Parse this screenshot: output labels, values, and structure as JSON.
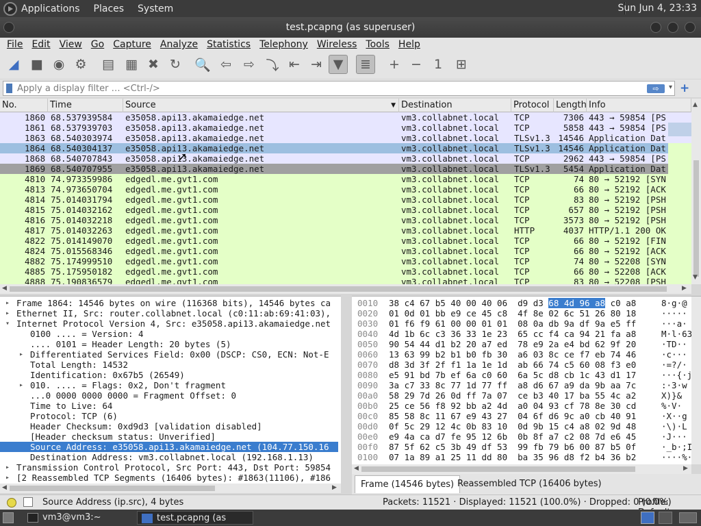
{
  "system_panel": {
    "menus": [
      "Applications",
      "Places",
      "System"
    ],
    "clock": "Sun Jun 4, 23:33"
  },
  "window": {
    "title": "test.pcapng (as superuser)"
  },
  "menubar": [
    "File",
    "Edit",
    "View",
    "Go",
    "Capture",
    "Analyze",
    "Statistics",
    "Telephony",
    "Wireless",
    "Tools",
    "Help"
  ],
  "toolbar": [
    {
      "name": "start-capture",
      "glyph": "◢"
    },
    {
      "name": "stop-capture",
      "glyph": "■"
    },
    {
      "name": "restart-capture",
      "glyph": "◉"
    },
    {
      "name": "capture-options",
      "glyph": "⚙"
    },
    {
      "name": "open-file",
      "glyph": "▤"
    },
    {
      "name": "save-file",
      "glyph": "▦"
    },
    {
      "name": "close-file",
      "glyph": "✖"
    },
    {
      "name": "reload-file",
      "glyph": "↻"
    },
    {
      "name": "find-packet",
      "glyph": "🔍"
    },
    {
      "name": "go-back",
      "glyph": "⇦"
    },
    {
      "name": "go-forward",
      "glyph": "⇨"
    },
    {
      "name": "go-to-packet",
      "glyph": "⤵"
    },
    {
      "name": "go-first",
      "glyph": "⇤"
    },
    {
      "name": "go-last",
      "glyph": "⇥"
    },
    {
      "name": "auto-scroll",
      "glyph": "▼"
    },
    {
      "name": "colorize",
      "glyph": "≣"
    },
    {
      "name": "zoom-in",
      "glyph": "+"
    },
    {
      "name": "zoom-out",
      "glyph": "−"
    },
    {
      "name": "normal-size",
      "glyph": "1"
    },
    {
      "name": "resize-columns",
      "glyph": "⊞"
    }
  ],
  "filter": {
    "placeholder": "Apply a display filter … <Ctrl-/>",
    "apply": "⇨",
    "add": "+"
  },
  "packet_list": {
    "columns": [
      "No.",
      "Time",
      "Source",
      "Destination",
      "Protocol",
      "Length",
      "Info"
    ],
    "rows": [
      {
        "no": "1860",
        "time": "68.537939584",
        "src": "e35058.api13.akamaiedge.net",
        "dst": "vm3.collabnet.local",
        "proto": "TCP",
        "len": "7306",
        "info": "443 → 59854 [PS",
        "color": "blue"
      },
      {
        "no": "1861",
        "time": "68.537939703",
        "src": "e35058.api13.akamaiedge.net",
        "dst": "vm3.collabnet.local",
        "proto": "TCP",
        "len": "5858",
        "info": "443 → 59854 [PS",
        "color": "blue"
      },
      {
        "no": "1863",
        "time": "68.540303974",
        "src": "e35058.api13.akamaiedge.net",
        "dst": "vm3.collabnet.local",
        "proto": "TLSv1.3",
        "len": "14546",
        "info": "Application Dat",
        "color": "blue"
      },
      {
        "no": "1864",
        "time": "68.540304137",
        "src": "e35058.api13.akamaiedge.net",
        "dst": "vm3.collabnet.local",
        "proto": "TLSv1.3",
        "len": "14546",
        "info": "Application Dat",
        "color": "sel"
      },
      {
        "no": "1868",
        "time": "68.540707843",
        "src": "e35058.api13.akamaiedge.net",
        "dst": "vm3.collabnet.local",
        "proto": "TCP",
        "len": "2962",
        "info": "443 → 59854 [PS",
        "color": "blue"
      },
      {
        "no": "1869",
        "time": "68.540707955",
        "src": "e35058.api13.akamaiedge.net",
        "dst": "vm3.collabnet.local",
        "proto": "TLSv1.3",
        "len": "5454",
        "info": "Application Dat",
        "color": "gray"
      },
      {
        "no": "4810",
        "time": "74.973359986",
        "src": "edgedl.me.gvt1.com",
        "dst": "vm3.collabnet.local",
        "proto": "TCP",
        "len": "74",
        "info": "80 → 52192 [SYN",
        "color": "green"
      },
      {
        "no": "4813",
        "time": "74.973650704",
        "src": "edgedl.me.gvt1.com",
        "dst": "vm3.collabnet.local",
        "proto": "TCP",
        "len": "66",
        "info": "80 → 52192 [ACK",
        "color": "green"
      },
      {
        "no": "4814",
        "time": "75.014031794",
        "src": "edgedl.me.gvt1.com",
        "dst": "vm3.collabnet.local",
        "proto": "TCP",
        "len": "83",
        "info": "80 → 52192 [PSH",
        "color": "green"
      },
      {
        "no": "4815",
        "time": "75.014032162",
        "src": "edgedl.me.gvt1.com",
        "dst": "vm3.collabnet.local",
        "proto": "TCP",
        "len": "657",
        "info": "80 → 52192 [PSH",
        "color": "green"
      },
      {
        "no": "4816",
        "time": "75.014032218",
        "src": "edgedl.me.gvt1.com",
        "dst": "vm3.collabnet.local",
        "proto": "TCP",
        "len": "3573",
        "info": "80 → 52192 [PSH",
        "color": "green"
      },
      {
        "no": "4817",
        "time": "75.014032263",
        "src": "edgedl.me.gvt1.com",
        "dst": "vm3.collabnet.local",
        "proto": "HTTP",
        "len": "4037",
        "info": "HTTP/1.1 200 OK",
        "color": "green"
      },
      {
        "no": "4822",
        "time": "75.014149070",
        "src": "edgedl.me.gvt1.com",
        "dst": "vm3.collabnet.local",
        "proto": "TCP",
        "len": "66",
        "info": "80 → 52192 [FIN",
        "color": "green"
      },
      {
        "no": "4824",
        "time": "75.015568346",
        "src": "edgedl.me.gvt1.com",
        "dst": "vm3.collabnet.local",
        "proto": "TCP",
        "len": "66",
        "info": "80 → 52192 [ACK",
        "color": "green"
      },
      {
        "no": "4882",
        "time": "75.174999510",
        "src": "edgedl.me.gvt1.com",
        "dst": "vm3.collabnet.local",
        "proto": "TCP",
        "len": "74",
        "info": "80 → 52208 [SYN",
        "color": "green"
      },
      {
        "no": "4885",
        "time": "75.175950182",
        "src": "edgedl.me.gvt1.com",
        "dst": "vm3.collabnet.local",
        "proto": "TCP",
        "len": "66",
        "info": "80 → 52208 [ACK",
        "color": "green"
      },
      {
        "no": "4888",
        "time": "75.190836579",
        "src": "edgedl.me.gvt1.com",
        "dst": "vm3.collabnet.local",
        "proto": "TCP",
        "len": "83",
        "info": "80 → 52208 [PSH",
        "color": "green"
      }
    ]
  },
  "details": [
    {
      "text": "Frame 1864: 14546 bytes on wire (116368 bits), 14546 bytes ca",
      "level": 0,
      "toggle": "▸"
    },
    {
      "text": "Ethernet II, Src: router.collabnet.local (c0:11:ab:69:41:03),",
      "level": 0,
      "toggle": "▸"
    },
    {
      "text": "Internet Protocol Version 4, Src: e35058.api13.akamaiedge.net",
      "level": 0,
      "toggle": "▾"
    },
    {
      "text": "0100 .... = Version: 4",
      "level": 1,
      "toggle": ""
    },
    {
      "text": ".... 0101 = Header Length: 20 bytes (5)",
      "level": 1,
      "toggle": ""
    },
    {
      "text": "Differentiated Services Field: 0x00 (DSCP: CS0, ECN: Not-E",
      "level": 1,
      "toggle": "▸"
    },
    {
      "text": "Total Length: 14532",
      "level": 1,
      "toggle": ""
    },
    {
      "text": "Identification: 0x67b5 (26549)",
      "level": 1,
      "toggle": ""
    },
    {
      "text": "010. .... = Flags: 0x2, Don't fragment",
      "level": 1,
      "toggle": "▸"
    },
    {
      "text": "...0 0000 0000 0000 = Fragment Offset: 0",
      "level": 1,
      "toggle": ""
    },
    {
      "text": "Time to Live: 64",
      "level": 1,
      "toggle": ""
    },
    {
      "text": "Protocol: TCP (6)",
      "level": 1,
      "toggle": ""
    },
    {
      "text": "Header Checksum: 0xd9d3 [validation disabled]",
      "level": 1,
      "toggle": ""
    },
    {
      "text": "[Header checksum status: Unverified]",
      "level": 1,
      "toggle": ""
    },
    {
      "text": "Source Address: e35058.api13.akamaiedge.net (104.77.150.16",
      "level": 1,
      "toggle": "",
      "selected": true
    },
    {
      "text": "Destination Address: vm3.collabnet.local (192.168.1.13)",
      "level": 1,
      "toggle": ""
    },
    {
      "text": "Transmission Control Protocol, Src Port: 443, Dst Port: 59854",
      "level": 0,
      "toggle": "▸"
    },
    {
      "text": "[2 Reassembled TCP Segments (16406 bytes): #1863(11106), #186",
      "level": 0,
      "toggle": "▸"
    }
  ],
  "hex": [
    {
      "off": "0010",
      "pre": "38 c4 67 b5 40 00 40 06  d9 d3 ",
      "hl": "68 4d 96 a8",
      "post": " c0 a8",
      "ascii": "8·g·@"
    },
    {
      "off": "0020",
      "pre": "01 0d 01 bb e9 ce 45 c8  4f 8e 02 6c 51 26 80 18",
      "hl": "",
      "post": "",
      "ascii": "·····"
    },
    {
      "off": "0030",
      "pre": "01 f6 f9 61 00 00 01 01  08 0a db 9a df 9a e5 ff",
      "hl": "",
      "post": "",
      "ascii": "···a·"
    },
    {
      "off": "0040",
      "pre": "4d 1b 6c c3 36 33 1e 23  65 cc f4 ca 94 21 fa a8",
      "hl": "",
      "post": "",
      "ascii": "M·l·63"
    },
    {
      "off": "0050",
      "pre": "90 54 44 d1 b2 20 a7 ed  78 e9 2a e4 bd 62 9f 20",
      "hl": "",
      "post": "",
      "ascii": "·TD··"
    },
    {
      "off": "0060",
      "pre": "13 63 99 b2 b1 b0 fb 30  a6 03 8c ce f7 eb 74 46",
      "hl": "",
      "post": "",
      "ascii": "·c···"
    },
    {
      "off": "0070",
      "pre": "d8 3d 3f 2f f1 1a 1e 1d  ab 66 74 c5 60 08 f3 e0",
      "hl": "",
      "post": "",
      "ascii": "·=?/·"
    },
    {
      "off": "0080",
      "pre": "e5 91 bd 7b ef 6a c0 60  6a 5c d8 cb 1c 43 d1 17",
      "hl": "",
      "post": "",
      "ascii": "···{·j"
    },
    {
      "off": "0090",
      "pre": "3a c7 33 8c 77 1d 77 ff  a8 d6 67 a9 da 9b aa 7c",
      "hl": "",
      "post": "",
      "ascii": ":·3·w"
    },
    {
      "off": "00a0",
      "pre": "58 29 7d 26 0d ff 7a 07  ce b3 40 17 ba 55 4c a2",
      "hl": "",
      "post": "",
      "ascii": "X)}&"
    },
    {
      "off": "00b0",
      "pre": "25 ce 56 f8 92 bb a2 4d  a0 04 93 cf 78 8e 30 cd",
      "hl": "",
      "post": "",
      "ascii": "%·V·"
    },
    {
      "off": "00c0",
      "pre": "85 58 8c 11 67 e9 43 27  04 6f d6 9c a0 cb 40 91",
      "hl": "",
      "post": "",
      "ascii": "·X··g"
    },
    {
      "off": "00d0",
      "pre": "0f 5c 29 12 4c 0b 83 10  0d 9b 15 c4 a8 02 9d 48",
      "hl": "",
      "post": "",
      "ascii": "·\\)·L"
    },
    {
      "off": "00e0",
      "pre": "e9 4a ca d7 fe 95 12 6b  0b 8f a7 c2 08 7d e6 45",
      "hl": "",
      "post": "",
      "ascii": "·J···"
    },
    {
      "off": "00f0",
      "pre": "87 5f 62 c5 3b 49 df 53  99 fb 79 b6 00 87 b5 0f",
      "hl": "",
      "post": "",
      "ascii": "·_b·;I"
    },
    {
      "off": "0100",
      "pre": "07 1a 89 a1 25 11 dd 80  ba 35 96 d8 f2 b4 36 b2",
      "hl": "",
      "post": "",
      "ascii": "····%·"
    }
  ],
  "hex_tabs": [
    "Frame (14546 bytes)",
    "Reassembled TCP (16406 bytes)"
  ],
  "status": {
    "field": "Source Address (ip.src), 4 bytes",
    "packets": "Packets: 11521 · Displayed: 11521 (100.0%) · Dropped: 0 (0.0%)",
    "profile": "Profile: Default"
  },
  "taskbar": {
    "items": [
      "vm3@vm3:~",
      "test.pcapng (as supe…"
    ]
  },
  "colors": {
    "row_blue": "#e7e6ff",
    "row_green": "#e4ffc7",
    "row_selected": "#9dbfe0",
    "row_gray": "#a0a0a0",
    "tree_selected": "#3a7dce"
  }
}
